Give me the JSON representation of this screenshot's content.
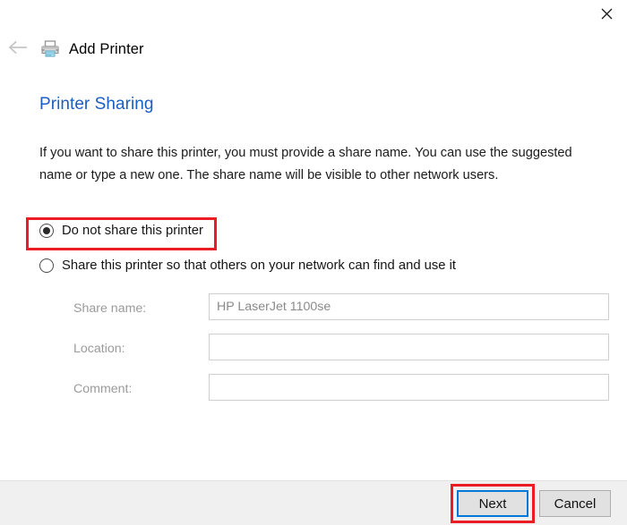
{
  "window": {
    "title": "Add Printer",
    "close_label": "✕",
    "back_label": "←",
    "printer_icon": "printer-icon",
    "close_icon": "close-icon",
    "back_icon": "back-arrow-icon"
  },
  "page": {
    "heading": "Printer Sharing",
    "heading_color": "#1a5ec4",
    "description": "If you want to share this printer, you must provide a share name. You can use the suggested name or type a new one. The share name will be visible to other network users."
  },
  "options": {
    "selected": "do_not_share",
    "items": [
      {
        "id": "do_not_share",
        "label": "Do not share this printer",
        "checked": true
      },
      {
        "id": "share",
        "label": "Share this printer so that others on your network can find and use it",
        "checked": false
      }
    ]
  },
  "form": {
    "fields": [
      {
        "label": "Share name:",
        "value": "HP LaserJet 1100se",
        "placeholder": ""
      },
      {
        "label": "Location:",
        "value": "",
        "placeholder": ""
      },
      {
        "label": "Comment:",
        "value": "",
        "placeholder": ""
      }
    ]
  },
  "footer": {
    "next_label": "Next",
    "cancel_label": "Cancel"
  },
  "highlights": {
    "color": "#ec1c24",
    "focus_color": "#0078d7"
  }
}
